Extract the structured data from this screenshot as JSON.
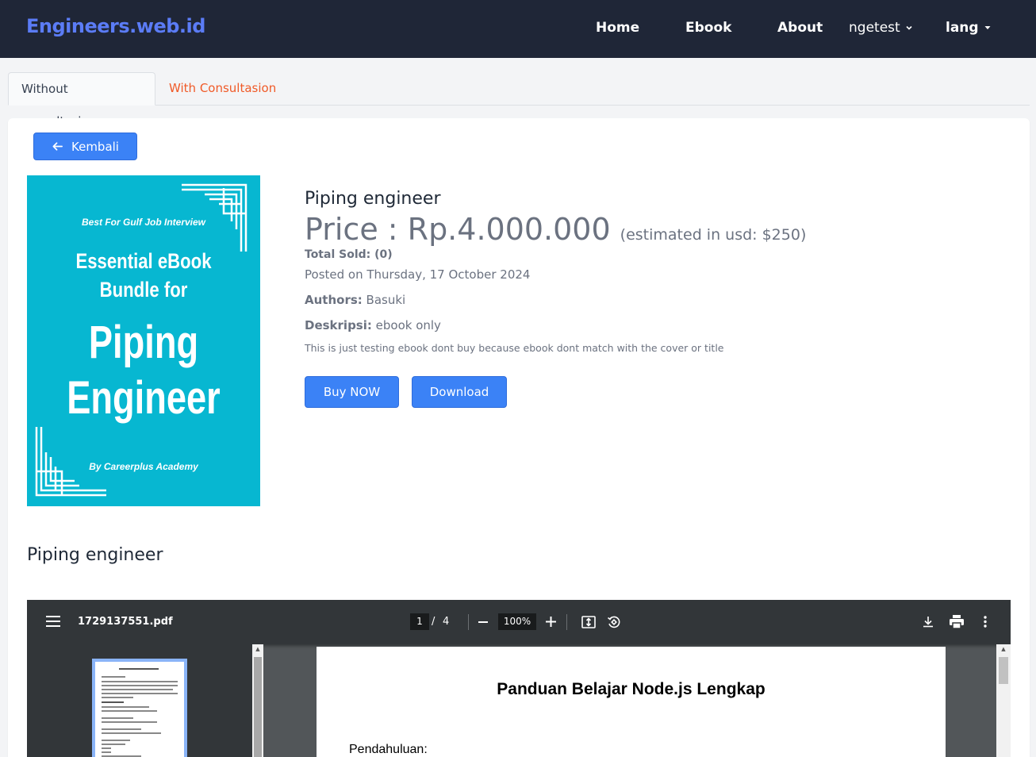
{
  "navbar": {
    "brand": "Engineers.web.id",
    "links": [
      "Home",
      "Ebook",
      "About"
    ],
    "user_menu": "ngetest",
    "lang_menu": "lang"
  },
  "tabs": {
    "active": "Without consultasion",
    "inactive": "With Consultasion"
  },
  "back_button": "Kembali",
  "cover": {
    "tagline": "Best For Gulf Job Interview",
    "line1": "Essential eBook",
    "line2": "Bundle for",
    "line3": "Piping",
    "line4": "Engineer",
    "byline": "By Careerplus Academy"
  },
  "product": {
    "title": "Piping engineer",
    "price": "Price : Rp.4.000.000",
    "usd": "(estimated in usd: $250)",
    "total_sold": "Total Sold: (0)",
    "posted": "Posted on Thursday, 17 October 2024",
    "authors_label": "Authors:",
    "authors_value": " Basuki",
    "desc_label": "Deskripsi:",
    "desc_value": " ebook only",
    "note": "This is just testing ebook dont buy because ebook dont match with the cover or title",
    "buy_label": "Buy NOW",
    "download_label": "Download"
  },
  "section_title": "Piping engineer",
  "pdf_viewer": {
    "filename": "1729137551.pdf",
    "current_page": "1",
    "separator": "/",
    "total_pages": "4",
    "zoom": "100%",
    "page_heading": "Panduan Belajar Node.js Lengkap",
    "page_section": "Pendahuluan:"
  },
  "colors": {
    "navbar_bg": "#1f2637",
    "brand": "#5b7cf6",
    "primary_button": "#3b82f6",
    "inactive_tab": "#f05a28",
    "cover_bg": "#07b7d1",
    "pdf_toolbar": "#323639"
  }
}
